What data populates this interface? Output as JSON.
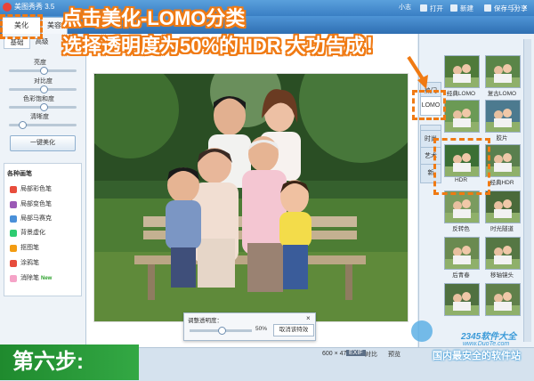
{
  "app": {
    "title": "美图秀秀 3.5",
    "user": "小志"
  },
  "toolbar": {
    "open": "打开",
    "new": "新建",
    "save_share": "保存与分享"
  },
  "top_tabs": [
    "美化",
    "美容"
  ],
  "left": {
    "subtabs": [
      "基础",
      "高级"
    ],
    "sliders": [
      {
        "label": "亮度",
        "value": 0.5
      },
      {
        "label": "对比度",
        "value": 0.5
      },
      {
        "label": "色彩饱和度",
        "value": 0.5
      },
      {
        "label": "清晰度",
        "value": 0.15
      }
    ],
    "one_click": "一键美化",
    "brushes_title": "各种画笔",
    "brushes": [
      {
        "label": "局部彩色笔",
        "color": "#e84d3c"
      },
      {
        "label": "局部变色笔",
        "color": "#9b59b6"
      },
      {
        "label": "局部马赛克",
        "color": "#4a90d9"
      },
      {
        "label": "背景虚化",
        "color": "#2ecc71"
      },
      {
        "label": "抠图笔",
        "color": "#f39c12"
      },
      {
        "label": "涂鸦笔",
        "color": "#e74c3c"
      },
      {
        "label": "消除笔",
        "color": "#f5a3c7"
      }
    ],
    "new_badge": "New"
  },
  "opacity": {
    "title": "调整透明度：",
    "percent": "50%",
    "value": 0.5,
    "cancel": "取消该特效"
  },
  "right": {
    "categories": [
      "热门",
      "LOMO",
      "影楼",
      "时尚",
      "艺术",
      "新"
    ],
    "thumbs": [
      {
        "label": "经典LOMO"
      },
      {
        "label": "复古LOMO"
      },
      {
        "label": ""
      },
      {
        "label": "胶片"
      },
      {
        "label": "HDR"
      },
      {
        "label": "经典HDR"
      },
      {
        "label": "反转色"
      },
      {
        "label": "时光隧道"
      },
      {
        "label": "后青春"
      },
      {
        "label": "移轴镜头"
      },
      {
        "label": ""
      },
      {
        "label": ""
      }
    ]
  },
  "status": {
    "size": "600 × 479",
    "exif": "EXIF",
    "compare": "对比",
    "preview": "预览"
  },
  "annotations": {
    "line1": "点击美化-LOMO分类",
    "line2": "选择透明度为50%的HDR 大功告成！",
    "step": "第六步:"
  },
  "watermark": {
    "site": "2345软件大全",
    "domain": "www.DuoTe.com",
    "slogan": "国内最安全的软件站"
  }
}
